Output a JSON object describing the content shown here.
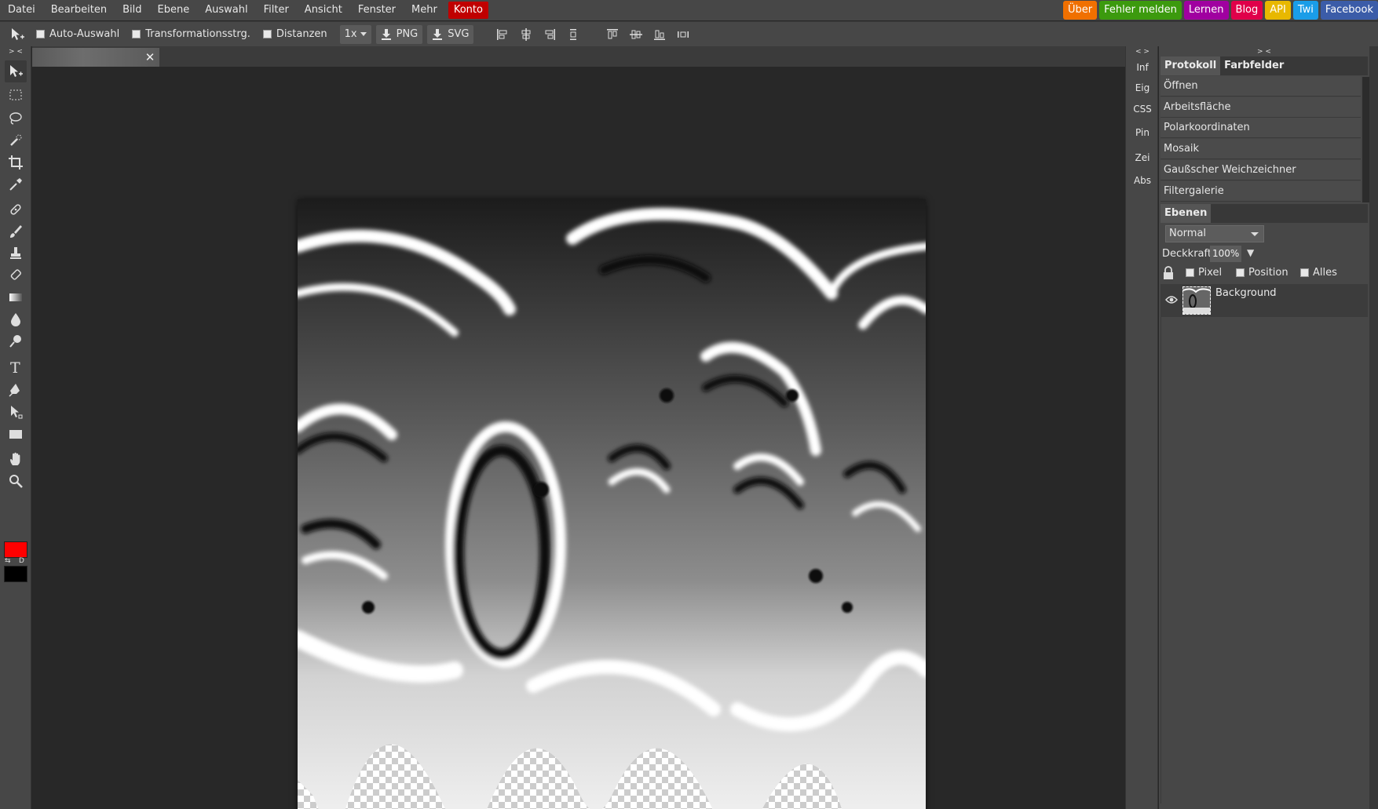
{
  "menu": [
    "Datei",
    "Bearbeiten",
    "Bild",
    "Ebene",
    "Auswahl",
    "Filter",
    "Ansicht",
    "Fenster",
    "Mehr"
  ],
  "account_label": "Konto",
  "ext_links": [
    {
      "label": "Über",
      "color": "#f07000"
    },
    {
      "label": "Fehler melden",
      "color": "#3c9a0e"
    },
    {
      "label": "Lernen",
      "color": "#a000a0"
    },
    {
      "label": "Blog",
      "color": "#e0004a"
    },
    {
      "label": "API",
      "color": "#e8b800"
    },
    {
      "label": "Twi",
      "color": "#1a9de8"
    },
    {
      "label": "Facebook",
      "color": "#3b5ca8"
    }
  ],
  "options": {
    "auto_select": "Auto-Auswahl",
    "transform": "Transformationsstrg.",
    "distances": "Distanzen",
    "scale": "1x",
    "png": "PNG",
    "svg": "SVG"
  },
  "toolbar": {
    "collapse": "> <",
    "swap": "⇆",
    "default": "D",
    "fg_color": "#ff0000",
    "bg_color": "#000000"
  },
  "doc_tab": {
    "close": "✕"
  },
  "mid_panel": {
    "collapse": "< >",
    "items": [
      "Inf",
      "Eig",
      "CSS",
      "Pin",
      "Zei",
      "Abs"
    ]
  },
  "right_panel": {
    "collapse": "> <",
    "tabs": [
      "Protokoll",
      "Farbfelder"
    ],
    "history": [
      "Öffnen",
      "Arbeitsfläche",
      "Polarkoordinaten",
      "Mosaik",
      "Gaußscher Weichzeichner",
      "Filtergalerie"
    ],
    "layers_tab": "Ebenen",
    "blend_mode": "Normal",
    "opacity_label": "Deckkraft:",
    "opacity_value": "100%",
    "lock_options": [
      "Pixel",
      "Position",
      "Alles"
    ],
    "layer_name": "Background"
  }
}
